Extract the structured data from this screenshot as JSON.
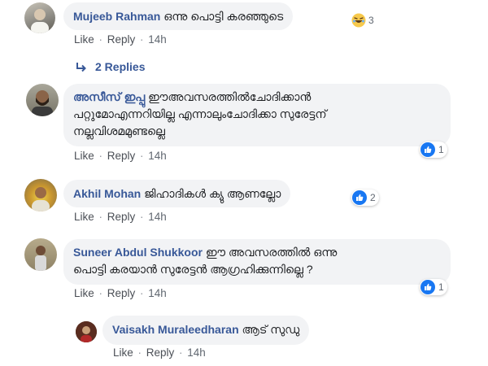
{
  "comments": [
    {
      "author": "Mujeeb Rahman",
      "text": "ഒന്നു പൊട്ടി കരഞ്ഞുടെ",
      "like": "Like",
      "reply": "Reply",
      "time": "14h",
      "reaction": {
        "type": "haha",
        "count": "3"
      },
      "replies_label": "2 Replies"
    },
    {
      "author": "അസീസ് ഇപ്പു",
      "text_line1": "ഈഅവസരത്തിൽചോദിക്കാൻ",
      "text_line2": "പറ്റുമോഎന്നറിയില്ല എന്നാലുംചോദിക്കാ സുരേട്ടന്",
      "text_line3": "നല്ലവിശമമുണ്ടല്ലെ",
      "like": "Like",
      "reply": "Reply",
      "time": "14h",
      "reaction": {
        "type": "like",
        "count": "1"
      }
    },
    {
      "author": "Akhil Mohan",
      "text": "ജിഹാദികൾ ക്യു ആണല്ലോ",
      "like": "Like",
      "reply": "Reply",
      "time": "14h",
      "reaction": {
        "type": "like",
        "count": "2"
      }
    },
    {
      "author": "Suneer Abdul Shukkoor",
      "text_line1": "ഈ അവസരത്തിൽ ഒന്നു",
      "text_line2": "പൊട്ടി കരയാൻ സുരേട്ടൻ ആഗ്രഹിക്കുന്നില്ലെ ?",
      "like": "Like",
      "reply": "Reply",
      "time": "14h",
      "reaction": {
        "type": "like",
        "count": "1"
      }
    },
    {
      "author": "Vaisakh Muraleedharan",
      "text": "ആട് സുഡു",
      "like": "Like",
      "reply": "Reply",
      "time": "14h"
    }
  ],
  "icons": {
    "reply_arrow": "reply-arrow-icon",
    "like": "like-icon",
    "haha": "haha-icon"
  },
  "colors": {
    "author": "#385898",
    "bubble": "#f2f3f5",
    "like_blue": "#1877f2",
    "meta": "#606770"
  }
}
